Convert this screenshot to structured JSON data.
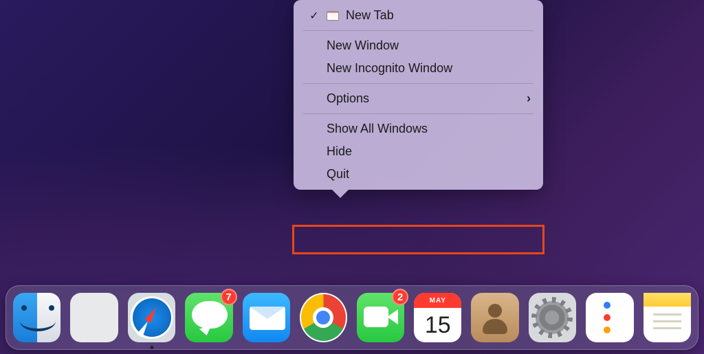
{
  "contextMenu": {
    "items": [
      {
        "label": "New Tab",
        "checked": true,
        "hasTabIcon": true
      },
      {
        "label": "New Window"
      },
      {
        "label": "New Incognito Window"
      },
      {
        "label": "Options",
        "hasArrow": true
      },
      {
        "label": "Show All Windows"
      },
      {
        "label": "Hide"
      },
      {
        "label": "Quit"
      }
    ]
  },
  "calendar": {
    "month": "MAY",
    "day": "15"
  },
  "dock": {
    "messagesBadge": "7",
    "facetimeBadge": "2"
  }
}
